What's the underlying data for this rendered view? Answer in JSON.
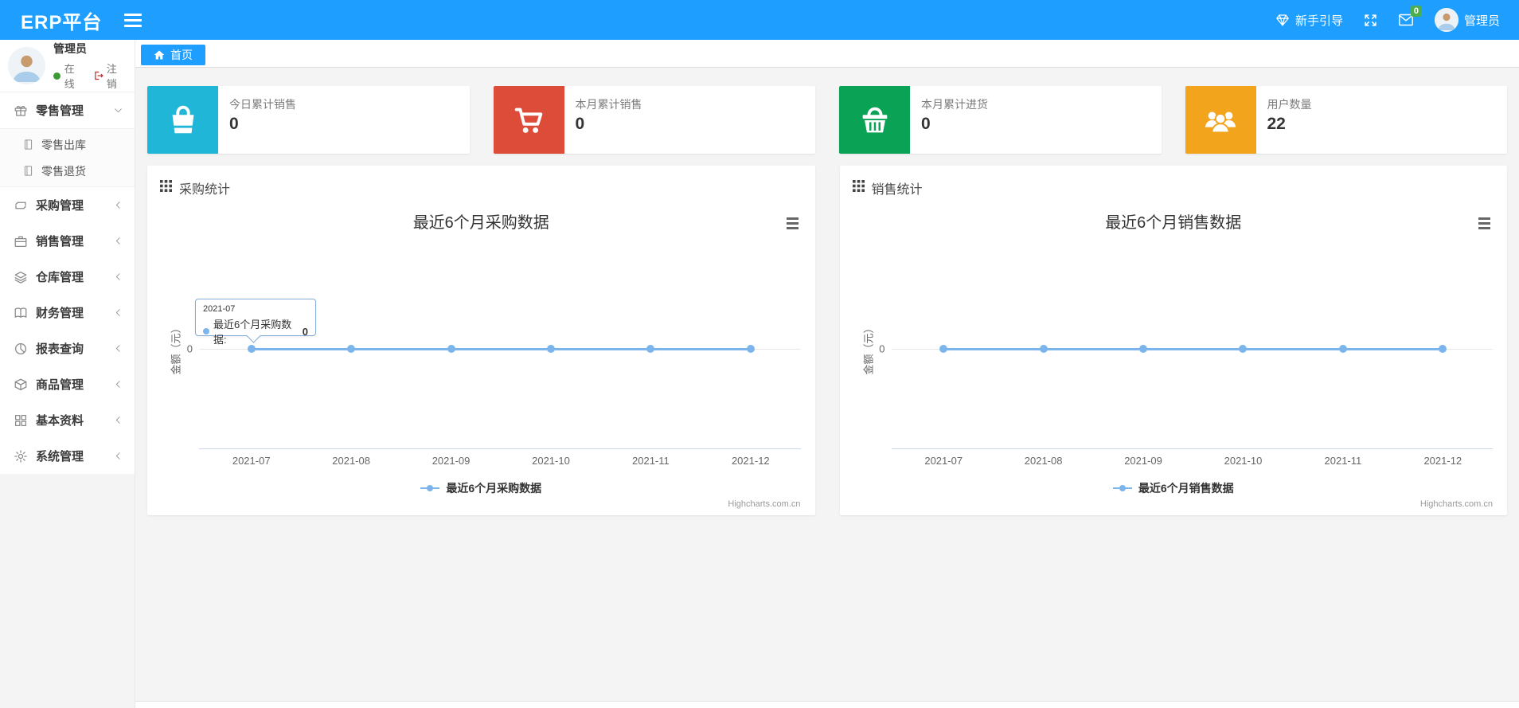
{
  "navbar": {
    "brand": "ERP平台",
    "guide_label": "新手引导",
    "mail_badge": "0",
    "user_name": "管理员",
    "accent_color": "#1E9FFF"
  },
  "sidebar": {
    "user": {
      "name": "管理员",
      "status": "在线",
      "logout_label": "注销",
      "online_color": "#3d9b35"
    },
    "menu": [
      {
        "label": "零售管理",
        "icon": "gift-icon",
        "state": "expanded",
        "children": [
          {
            "label": "零售出库",
            "icon": "journal-icon"
          },
          {
            "label": "零售退货",
            "icon": "journal-icon"
          }
        ]
      },
      {
        "label": "采购管理",
        "icon": "repeat-icon",
        "state": "collapsed"
      },
      {
        "label": "销售管理",
        "icon": "briefcase-icon",
        "state": "collapsed"
      },
      {
        "label": "仓库管理",
        "icon": "layers-icon",
        "state": "collapsed"
      },
      {
        "label": "财务管理",
        "icon": "open-book-icon",
        "state": "collapsed"
      },
      {
        "label": "报表查询",
        "icon": "pie-chart-icon",
        "state": "collapsed"
      },
      {
        "label": "商品管理",
        "icon": "package-icon",
        "state": "collapsed"
      },
      {
        "label": "基本资料",
        "icon": "grid-icon",
        "state": "collapsed"
      },
      {
        "label": "系统管理",
        "icon": "gear-icon",
        "state": "collapsed"
      }
    ]
  },
  "tabs": [
    {
      "label": "首页",
      "active": true
    }
  ],
  "stat_cards": [
    {
      "label": "今日累计销售",
      "value": "0",
      "color": "#20B6D8",
      "icon": "shopping-bag-icon"
    },
    {
      "label": "本月累计销售",
      "value": "0",
      "color": "#DD4B39",
      "icon": "cart-icon"
    },
    {
      "label": "本月累计进货",
      "value": "0",
      "color": "#0AA254",
      "icon": "basket-icon"
    },
    {
      "label": "用户数量",
      "value": "22",
      "color": "#F3A41D",
      "icon": "users-icon"
    }
  ],
  "panels": [
    {
      "header": "采购统计"
    },
    {
      "header": "销售统计"
    }
  ],
  "chart_data": [
    {
      "type": "line",
      "title": "最近6个月采购数据",
      "categories": [
        "2021-07",
        "2021-08",
        "2021-09",
        "2021-10",
        "2021-11",
        "2021-12"
      ],
      "series": [
        {
          "name": "最近6个月采购数据",
          "values": [
            0,
            0,
            0,
            0,
            0,
            0
          ],
          "color": "#7cb5ec"
        }
      ],
      "xlabel": "",
      "ylabel": "金额（元）",
      "yticks": [
        "0"
      ],
      "ylim": [
        -1,
        1
      ],
      "grid": "zero-line-only",
      "legend_position": "bottom",
      "credit": "Highcharts.com.cn",
      "tooltip": {
        "header": "2021-07",
        "series": "最近6个月采购数据",
        "value": "0"
      }
    },
    {
      "type": "line",
      "title": "最近6个月销售数据",
      "categories": [
        "2021-07",
        "2021-08",
        "2021-09",
        "2021-10",
        "2021-11",
        "2021-12"
      ],
      "series": [
        {
          "name": "最近6个月销售数据",
          "values": [
            0,
            0,
            0,
            0,
            0,
            0
          ],
          "color": "#7cb5ec"
        }
      ],
      "xlabel": "",
      "ylabel": "金额（元）",
      "yticks": [
        "0"
      ],
      "ylim": [
        -1,
        1
      ],
      "grid": "zero-line-only",
      "legend_position": "bottom",
      "credit": "Highcharts.com.cn",
      "tooltip": null
    }
  ]
}
